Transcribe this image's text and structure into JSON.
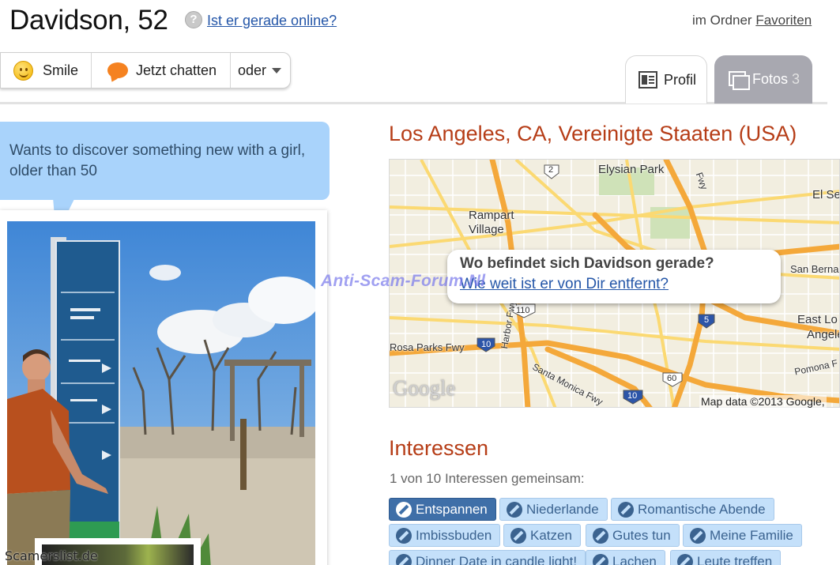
{
  "header": {
    "name": "Davidson, 52",
    "online_question": "Ist er gerade online?",
    "folder_prefix": "im Ordner",
    "folder_link": "Favoriten"
  },
  "actions": {
    "smile": "Smile",
    "chat": "Jetzt chatten",
    "more": "oder"
  },
  "tabs": {
    "profil": "Profil",
    "fotos": "Fotos",
    "fotos_count": "3"
  },
  "bio": "Wants to discover something new with a girl, older than 50",
  "location": {
    "title": "Los Angeles, CA, Vereinigte Staaten (USA)",
    "popup_question": "Wo befindet sich Davidson gerade?",
    "popup_link": "Wie weit ist er von Dir entfernt?",
    "map_labels": [
      "Elysian Park",
      "Rampart Village",
      "El Se",
      "San Bernar",
      "East Lo",
      "Angele",
      "Rosa Parks Fwy",
      "Harbor Fwy",
      "Santa Monica Fwy",
      "Pomona F",
      "Fwy",
      "2",
      "110",
      "10",
      "5",
      "60",
      "10"
    ],
    "google": "Google",
    "map_data": "Map data ©2013 Google,"
  },
  "watermarks": {
    "mid": "Anti-Scam-Forum.Nl",
    "bottom": "Scamerslist.de"
  },
  "interests": {
    "title": "Interessen",
    "common": "1 von 10 Interessen gemeinsam:",
    "tags": [
      "Entspannen",
      "Niederlande",
      "Romantische Abende",
      "Imbissbuden",
      "Katzen",
      "Gutes tun",
      "Meine Familie",
      "Dinner Date in candle light!",
      "Lachen",
      "Leute treffen"
    ]
  },
  "colors": {
    "accent_red": "#b63d17",
    "link_blue": "#2456a8",
    "bubble_blue": "#a9d3fb",
    "tag_active": "#3f6fa8",
    "tag_bg": "#c4e0fa"
  }
}
